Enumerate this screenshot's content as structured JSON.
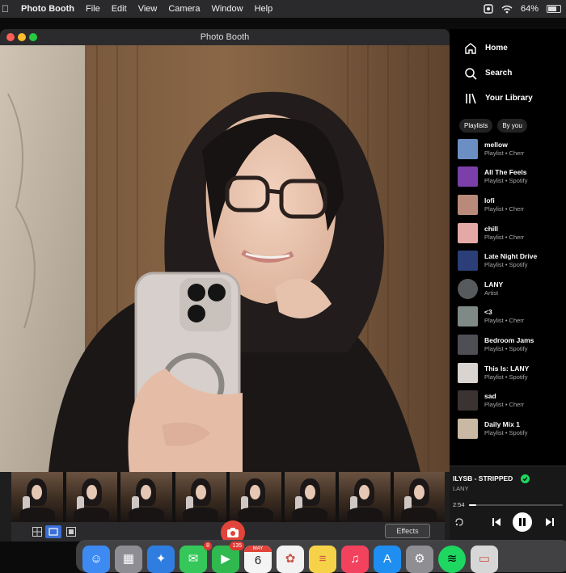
{
  "menubar": {
    "app_name": "Photo Booth",
    "menus": [
      "File",
      "Edit",
      "View",
      "Camera",
      "Window",
      "Help"
    ],
    "battery": "64%",
    "battery_level": 0.64
  },
  "photobooth": {
    "window_title": "Photo Booth",
    "effects_label": "Effects",
    "thumbnail_count": 8,
    "colors": {
      "close": "#ff5f57",
      "minimize": "#febc2e",
      "zoom": "#28c840",
      "shutter": "#e0443a"
    }
  },
  "spotify": {
    "nav": [
      {
        "label": "Home",
        "icon": "home-icon"
      },
      {
        "label": "Search",
        "icon": "search-icon"
      },
      {
        "label": "Your Library",
        "icon": "library-icon"
      }
    ],
    "chips": [
      "Playlists",
      "By you"
    ],
    "library": [
      {
        "title": "mellow",
        "subtitle": "Playlist • Cherr",
        "color": "#6b8fc2"
      },
      {
        "title": "All The Feels",
        "subtitle": "Playlist • Spotify",
        "color": "#7a3fa8"
      },
      {
        "title": "lofi",
        "subtitle": "Playlist • Cherr",
        "color": "#b98a7a"
      },
      {
        "title": "chill",
        "subtitle": "Playlist • Cherr",
        "color": "#e4a9a6"
      },
      {
        "title": "Late Night Drive",
        "subtitle": "Playlist • Spotify",
        "color": "#2b3e78"
      },
      {
        "title": "LANY",
        "subtitle": "Artist",
        "color": "#565a5c",
        "round": true
      },
      {
        "title": "<3",
        "subtitle": "Playlist • Cherr",
        "color": "#7f8a86"
      },
      {
        "title": "Bedroom Jams",
        "subtitle": "Playlist • Spotify",
        "color": "#4d4f55"
      },
      {
        "title": "This Is: LANY",
        "subtitle": "Playlist • Spotify",
        "color": "#d9d4cf"
      },
      {
        "title": "sad",
        "subtitle": "Playlist • Cherr",
        "color": "#3a3332"
      },
      {
        "title": "Daily Mix 1",
        "subtitle": "Playlist • Spotify",
        "color": "#c9b9a4"
      }
    ],
    "now_playing": {
      "title": "ILYSB - STRIPPED",
      "artist": "LANY",
      "elapsed": "2:54",
      "progress": 0.08,
      "accent": "#1ed760"
    }
  },
  "dock": {
    "apps": [
      {
        "name": "finder-icon",
        "color": "#3d8bf2"
      },
      {
        "name": "launchpad-icon",
        "color": "#8d8d93"
      },
      {
        "name": "safari-icon",
        "color": "#2f7de1"
      },
      {
        "name": "messages-icon",
        "color": "#35c759",
        "badge": "8"
      },
      {
        "name": "facetime-icon",
        "color": "#2fb94f",
        "badge": "135"
      },
      {
        "name": "calendar-icon",
        "color": "#f4f4f4",
        "month": "MAY",
        "day": "6"
      },
      {
        "name": "photos-icon",
        "color": "#f2f2f2"
      },
      {
        "name": "notes-icon",
        "color": "#f6d248"
      },
      {
        "name": "music-icon",
        "color": "#f2425e"
      },
      {
        "name": "app-store-icon",
        "color": "#1f8ef1"
      },
      {
        "name": "system-settings-icon",
        "color": "#8e8e93"
      },
      {
        "name": "spotify-icon",
        "color": "#1ed760"
      },
      {
        "name": "preview-icon",
        "color": "#d7d7d7"
      }
    ]
  }
}
